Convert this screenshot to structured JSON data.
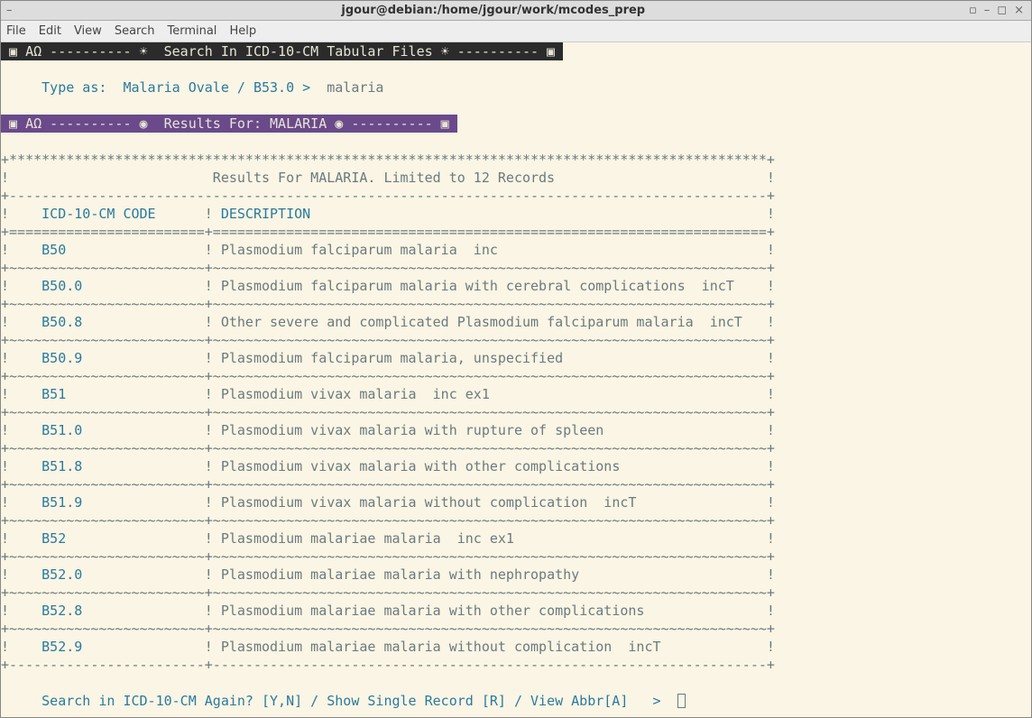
{
  "window": {
    "title": "jgour@debian:/home/jgour/work/mcodes_prep",
    "menus": [
      "File",
      "Edit",
      "View",
      "Search",
      "Terminal",
      "Help"
    ]
  },
  "header1": " ▣ AΩ ---------- ☀  Search In ICD-10-CM Tabular Files ☀ ---------- ▣ ",
  "header2": " ▣ AΩ ---------- ◉  Results For: MALARIA ◉ ---------- ▣ ",
  "typeas_label": "Type as:  Malaria Ovale / B53.0 >",
  "typeas_value": "malaria",
  "results_title": "Results For MALARIA. Limited to 12 Records",
  "col_code": "ICD-10-CM CODE",
  "col_desc": "DESCRIPTION",
  "rows": [
    {
      "code": "B50",
      "desc": "Plasmodium falciparum malaria  inc"
    },
    {
      "code": "B50.0",
      "desc": "Plasmodium falciparum malaria with cerebral complications  incT"
    },
    {
      "code": "B50.8",
      "desc": "Other severe and complicated Plasmodium falciparum malaria  incT"
    },
    {
      "code": "B50.9",
      "desc": "Plasmodium falciparum malaria, unspecified"
    },
    {
      "code": "B51",
      "desc": "Plasmodium vivax malaria  inc ex1"
    },
    {
      "code": "B51.0",
      "desc": "Plasmodium vivax malaria with rupture of spleen"
    },
    {
      "code": "B51.8",
      "desc": "Plasmodium vivax malaria with other complications"
    },
    {
      "code": "B51.9",
      "desc": "Plasmodium vivax malaria without complication  incT"
    },
    {
      "code": "B52",
      "desc": "Plasmodium malariae malaria  inc ex1"
    },
    {
      "code": "B52.0",
      "desc": "Plasmodium malariae malaria with nephropathy"
    },
    {
      "code": "B52.8",
      "desc": "Plasmodium malariae malaria with other complications"
    },
    {
      "code": "B52.9",
      "desc": "Plasmodium malariae malaria without complication  incT"
    }
  ],
  "prompt": "Search in ICD-10-CM Again? [Y,N] / Show Single Record [R] / View Abbr[A]   >"
}
